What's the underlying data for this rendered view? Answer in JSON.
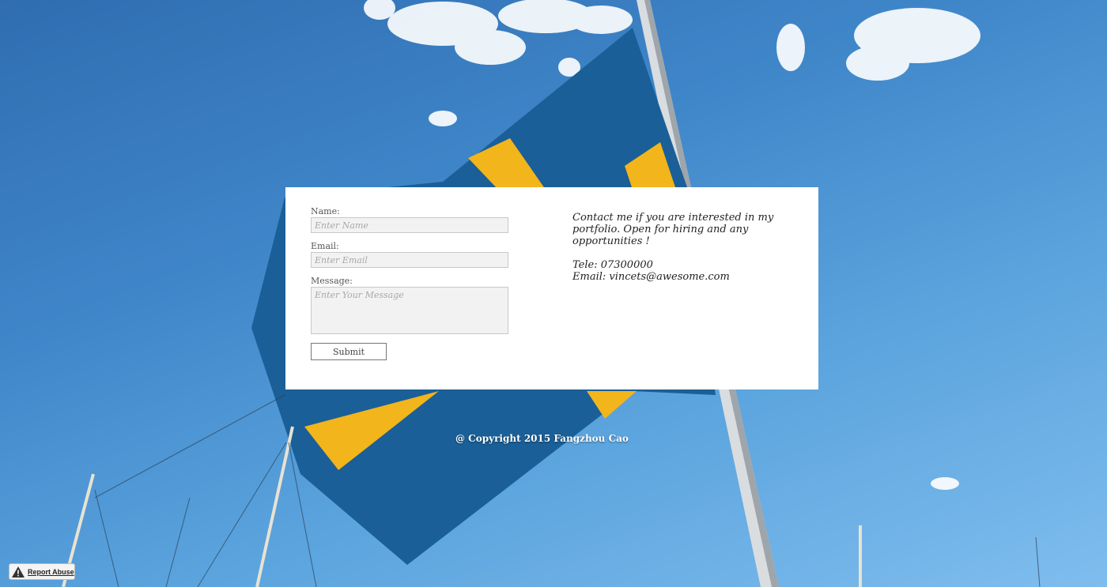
{
  "form": {
    "name_label": "Name:",
    "name_placeholder": "Enter Name",
    "email_label": "Email:",
    "email_placeholder": "Enter Email",
    "message_label": "Message:",
    "message_placeholder": "Enter Your Message",
    "submit_label": "Submit"
  },
  "contact_info": {
    "line1": "Contact me if you are interested in my",
    "line2": "portfolio. Open for hiring and any",
    "line3": "opportunities !",
    "phone": "Tele: 07300000",
    "email": "Email: vincets@awesome.com"
  },
  "footer": {
    "copyright": "@ Copyright 2015 Fangzhou Cao"
  },
  "report_abuse": {
    "label": "Report Abuse",
    "icon": "warning-icon"
  },
  "colors": {
    "sky": "#3f86c9",
    "flag_blue": "#1a5f97",
    "flag_yellow": "#f2b51b",
    "card_bg": "#ffffff"
  }
}
